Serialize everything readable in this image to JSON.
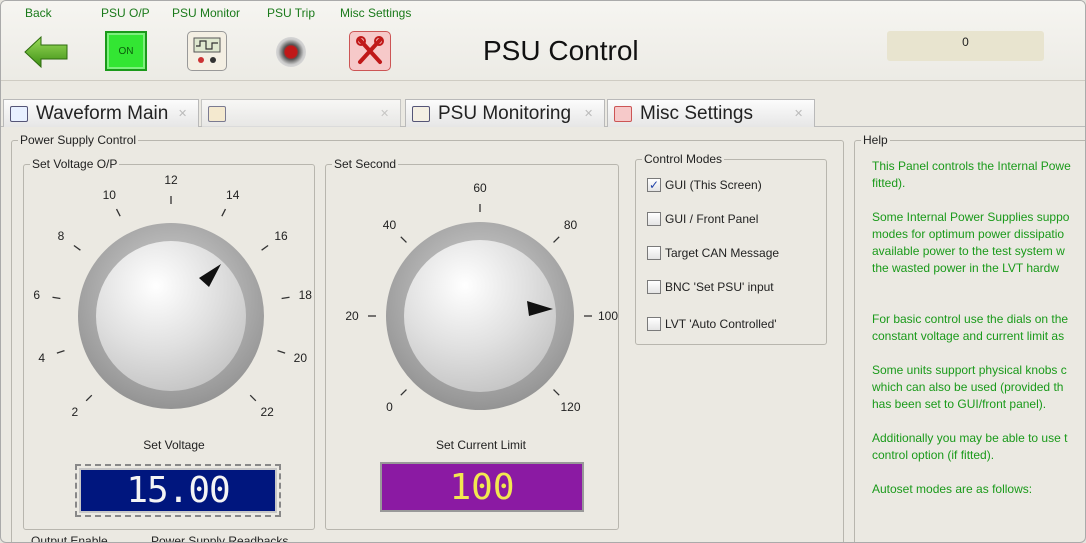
{
  "toolbar": {
    "labels": {
      "back": "Back",
      "psu_op": "PSU O/P",
      "psu_monitor": "PSU Monitor",
      "psu_trip": "PSU Trip",
      "misc_settings": "Misc Settings"
    },
    "on_label": "ON",
    "title": "PSU Control",
    "counter_value": "0"
  },
  "tabs": [
    {
      "label": "Waveform Main"
    },
    {
      "label": ""
    },
    {
      "label": "PSU Monitoring"
    },
    {
      "label": "Misc Settings"
    }
  ],
  "power_supply_control": {
    "label": "Power Supply Control",
    "voltage_group": {
      "label": "Set Voltage O/P",
      "dial_ticks": [
        "2",
        "4",
        "6",
        "8",
        "10",
        "12",
        "14",
        "16",
        "18",
        "20",
        "22"
      ],
      "dial_caption": "Set Voltage",
      "display_value": "15.00"
    },
    "second_group": {
      "label": "Set Second",
      "dial_ticks": [
        "0",
        "20",
        "40",
        "60",
        "80",
        "100",
        "120"
      ],
      "dial_caption": "Set Current Limit",
      "display_value": "100"
    },
    "control_modes": {
      "label": "Control Modes",
      "options": [
        {
          "label": "GUI (This Screen)",
          "checked": true
        },
        {
          "label": "GUI / Front Panel",
          "checked": false
        },
        {
          "label": "Target CAN Message",
          "checked": false
        },
        {
          "label": "BNC 'Set PSU' input",
          "checked": false
        },
        {
          "label": "LVT 'Auto Controlled'",
          "checked": false
        }
      ]
    },
    "bottom_labels": {
      "output_enable": "Output Enable",
      "readbacks": "Power Supply Readbacks"
    }
  },
  "help": {
    "label": "Help",
    "lines": [
      "This Panel controls the Internal Powe",
      "fitted).",
      "Some Internal Power Supplies suppo",
      "modes for optimum power dissipatio",
      "available power to the test system w",
      "the wasted power in the LVT hardw",
      "For basic control use the dials on the",
      "constant voltage and current limit as",
      "Some units support physical knobs c",
      "which can also be used (provided th",
      "has been set to GUI/front panel).",
      "Additionally you may be able to use t",
      "control option (if fitted).",
      "Autoset modes are as follows:"
    ]
  },
  "colors": {
    "accent_green": "#1a9a1a",
    "lcd_blue": "#00167e",
    "lcd_purple": "#8b1aa3",
    "lcd_yellow": "#f2e850"
  }
}
